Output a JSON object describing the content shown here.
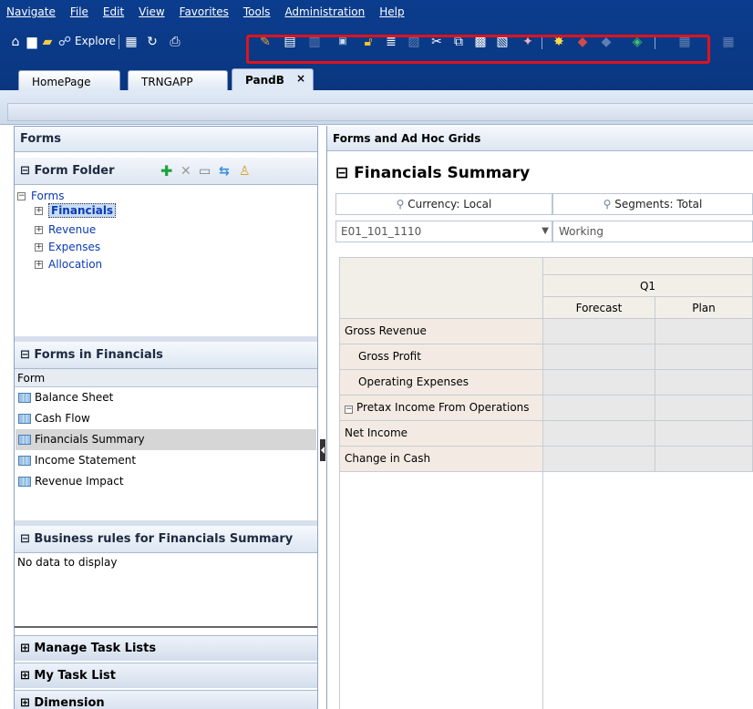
{
  "menu": [
    "Navigate",
    "File",
    "Edit",
    "View",
    "Favorites",
    "Tools",
    "Administration",
    "Help"
  ],
  "toolbar": {
    "explore_label": "Explore",
    "highlight_color": "#e0131b",
    "left_icons": [
      "home-icon",
      "document-icon",
      "folder-open-icon",
      "refresh-user-icon"
    ],
    "mid_icons": [
      "grid-icon",
      "refresh-icon",
      "print-icon"
    ],
    "highlighted_icons": [
      "pencil-icon",
      "adjust-icon",
      "spread-icon",
      "spellcheck-icon",
      "lock-icon",
      "indent-icon",
      "instructions-icon",
      "cut-icon",
      "copy-icon",
      "paste-icon",
      "paste-values-icon",
      "clear-icon",
      "calculate-icon",
      "validate-icon",
      "refresh-data-icon"
    ],
    "right_icons": [
      "grid-dim-icon",
      "grid-dim2-icon"
    ]
  },
  "tabs": [
    {
      "label": "HomePage"
    },
    {
      "label": "TRNGAPP"
    },
    {
      "label": "PandB",
      "close": "×"
    }
  ],
  "left": {
    "forms_header": "Forms",
    "form_folder": {
      "title": "Form Folder",
      "toggle": "⊟",
      "action_icons": [
        "add-folder-icon",
        "delete-folder-icon",
        "rename-folder-icon",
        "move-folder-icon",
        "assign-access-icon"
      ]
    },
    "tree": {
      "root": "Forms",
      "items": [
        {
          "label": "Financials",
          "selected": true
        },
        {
          "label": "Revenue"
        },
        {
          "label": "Expenses"
        },
        {
          "label": "Allocation"
        }
      ]
    },
    "forms_in": {
      "title": "Forms in Financials",
      "column": "Form",
      "items": [
        {
          "label": "Balance Sheet"
        },
        {
          "label": "Cash Flow"
        },
        {
          "label": "Financials Summary",
          "selected": true
        },
        {
          "label": "Income Statement"
        },
        {
          "label": "Revenue Impact"
        }
      ]
    },
    "rules": {
      "title": "Business rules for Financials Summary",
      "empty": "No data to display"
    },
    "collapsed": [
      "Manage Task Lists",
      "My Task List",
      "Dimension"
    ]
  },
  "right": {
    "header": "Forms and Ad Hoc Grids",
    "form_title": "Financials Summary",
    "pov": {
      "currency": "Currency: Local",
      "segments": "Segments: Total",
      "entity": "E01_101_1110",
      "scenario": "Working"
    },
    "grid": {
      "period": "Q1",
      "columns": [
        "Forecast",
        "Plan"
      ],
      "rows": [
        "Gross Revenue",
        "Gross Profit",
        "Operating Expenses",
        "Pretax Income From Operations",
        "Net Income",
        "Change in Cash"
      ]
    }
  }
}
